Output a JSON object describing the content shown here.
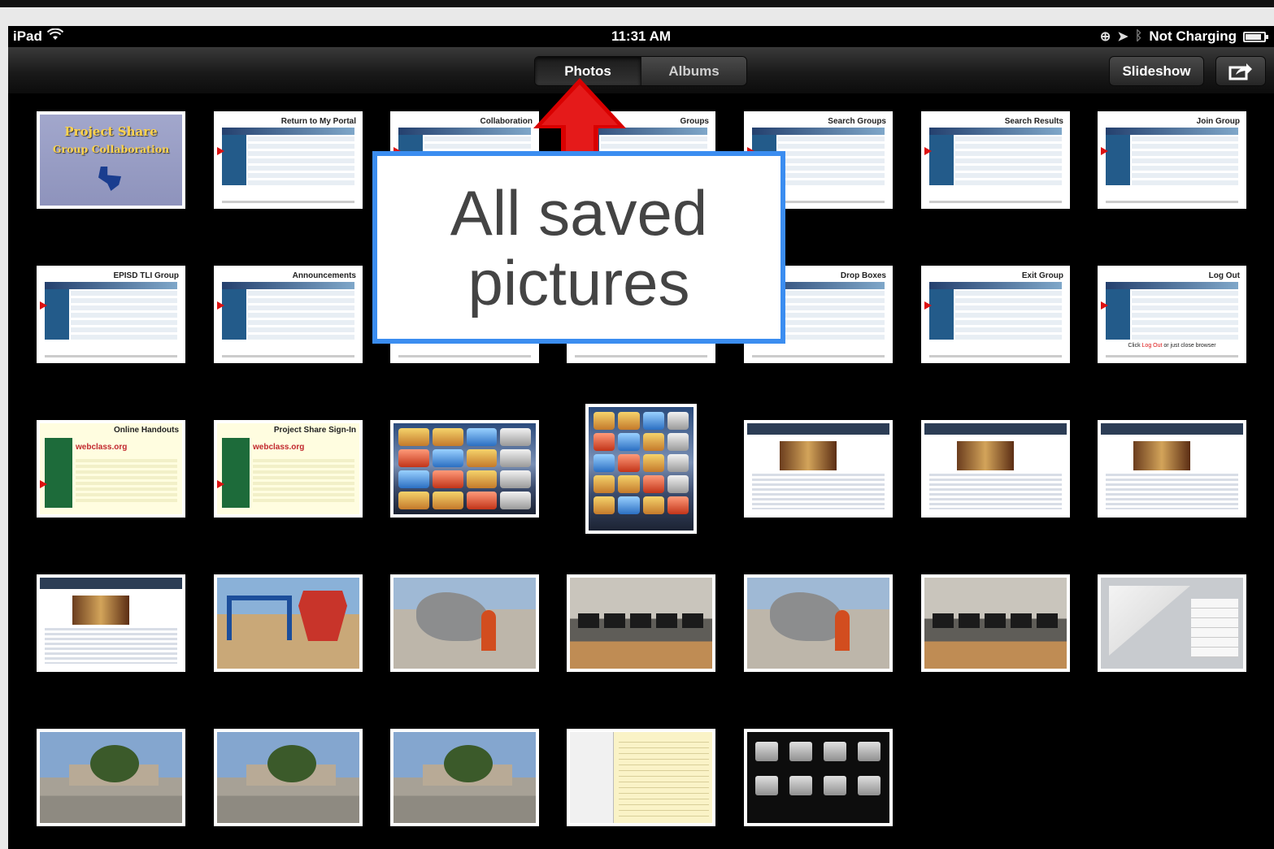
{
  "status": {
    "device": "iPad",
    "time": "11:31 AM",
    "charging": "Not Charging",
    "battery_level": 0.85
  },
  "toolbar": {
    "tabs": [
      {
        "label": "Photos",
        "active": true
      },
      {
        "label": "Albums",
        "active": false
      }
    ],
    "slideshow_label": "Slideshow",
    "share_icon": "share-icon"
  },
  "callout": {
    "text": "All saved pictures",
    "border_color": "#3b8df0",
    "arrow_color": "#d90000"
  },
  "photos": [
    {
      "kind": "cover",
      "line1": "Project Share",
      "line2": "Group Collaboration"
    },
    {
      "kind": "slide",
      "title": "Return to My Portal"
    },
    {
      "kind": "slide",
      "title": "Collaboration"
    },
    {
      "kind": "slide",
      "title": "Groups"
    },
    {
      "kind": "slide",
      "title": "Search Groups"
    },
    {
      "kind": "slide",
      "title": "Search Results"
    },
    {
      "kind": "slide",
      "title": "Join Group"
    },
    {
      "kind": "slide",
      "title": "EPISD TLI Group"
    },
    {
      "kind": "slide",
      "title": "Announcements"
    },
    {
      "kind": "slide",
      "title": ""
    },
    {
      "kind": "slide",
      "title": ""
    },
    {
      "kind": "slide",
      "title": "Drop Boxes"
    },
    {
      "kind": "slide",
      "title": "Exit Group"
    },
    {
      "kind": "slide",
      "title": "Log Out",
      "caption_pre": "Click ",
      "caption_red": "Log Out",
      "caption_post": " or just close browser"
    },
    {
      "kind": "webclass",
      "title": "Online Handouts",
      "site": "webclass.org"
    },
    {
      "kind": "webclass",
      "title": "Project Share Sign-In",
      "site": "webclass.org"
    },
    {
      "kind": "ipad-home"
    },
    {
      "kind": "ipad-home",
      "portrait": true
    },
    {
      "kind": "web"
    },
    {
      "kind": "web"
    },
    {
      "kind": "web"
    },
    {
      "kind": "web"
    },
    {
      "kind": "photo-play"
    },
    {
      "kind": "photo-sculpt"
    },
    {
      "kind": "photo-lab"
    },
    {
      "kind": "photo-sculpt"
    },
    {
      "kind": "photo-lab"
    },
    {
      "kind": "maps"
    },
    {
      "kind": "photo-street"
    },
    {
      "kind": "photo-street"
    },
    {
      "kind": "photo-street"
    },
    {
      "kind": "notes"
    },
    {
      "kind": "sheets"
    }
  ]
}
